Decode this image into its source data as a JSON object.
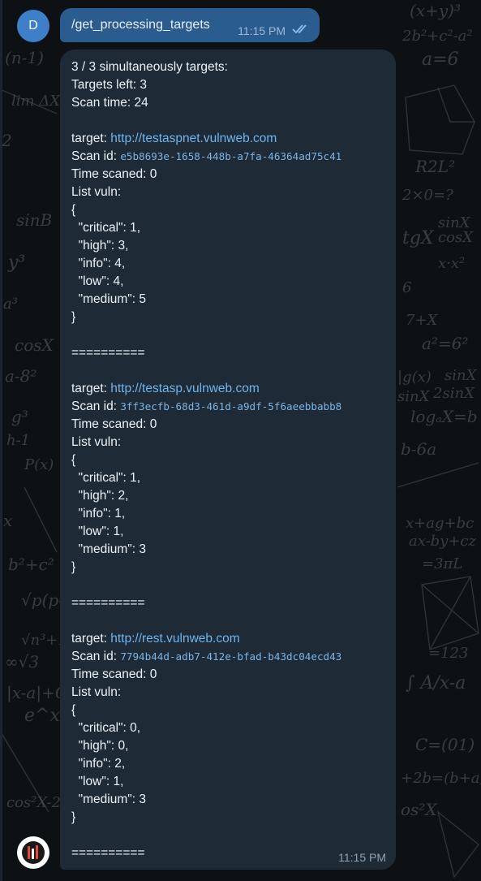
{
  "colors": {
    "background": "#0e1114",
    "command_bubble": "#2b5c8f",
    "message_bubble": "#1e2b37",
    "link": "#6fb4ee",
    "avatar": "#3d7fc8"
  },
  "command_message": {
    "avatar_letter": "D",
    "text": "/get_processing_targets",
    "time": "11:15 PM",
    "status_icon": "double-check-icon"
  },
  "bot_message": {
    "avatar_icon": "bot-logo-icon",
    "summary": {
      "line1": "3 / 3 simultaneously targets:",
      "line2": "Targets left: 3",
      "line3": "Scan time: 24"
    },
    "labels": {
      "target": "target: ",
      "scan_id": "Scan id: ",
      "separator": "=========="
    },
    "targets": [
      {
        "url": "http://testaspnet.vulnweb.com",
        "scan_id": "e5b8693e-1658-448b-a7fa-46364ad75c41",
        "time_scaned": "Time scaned: 0",
        "list_vuln": "List vuln:",
        "open_brace": "{",
        "critical": "  \"critical\": 1,",
        "high": "  \"high\": 3,",
        "info": "  \"info\": 4,",
        "low": "  \"low\": 4,",
        "medium": "  \"medium\": 5",
        "close_brace": "}"
      },
      {
        "url": "http://testasp.vulnweb.com",
        "scan_id": "3ff3ecfb-68d3-461d-a9df-5f6aeebbabb8",
        "time_scaned": "Time scaned: 0",
        "list_vuln": "List vuln:",
        "open_brace": "{",
        "critical": "  \"critical\": 1,",
        "high": "  \"high\": 2,",
        "info": "  \"info\": 1,",
        "low": "  \"low\": 1,",
        "medium": "  \"medium\": 3",
        "close_brace": "}"
      },
      {
        "url": "http://rest.vulnweb.com",
        "scan_id": "7794b44d-adb7-412e-bfad-b43dc04ecd43",
        "time_scaned": "Time scaned: 0",
        "list_vuln": "List vuln:",
        "open_brace": "{",
        "critical": "  \"critical\": 0,",
        "high": "  \"high\": 0,",
        "info": "  \"info\": 2,",
        "low": "  \"low\": 1,",
        "medium": "  \"medium\": 3",
        "close_brace": "}"
      }
    ],
    "time": "11:15 PM"
  }
}
